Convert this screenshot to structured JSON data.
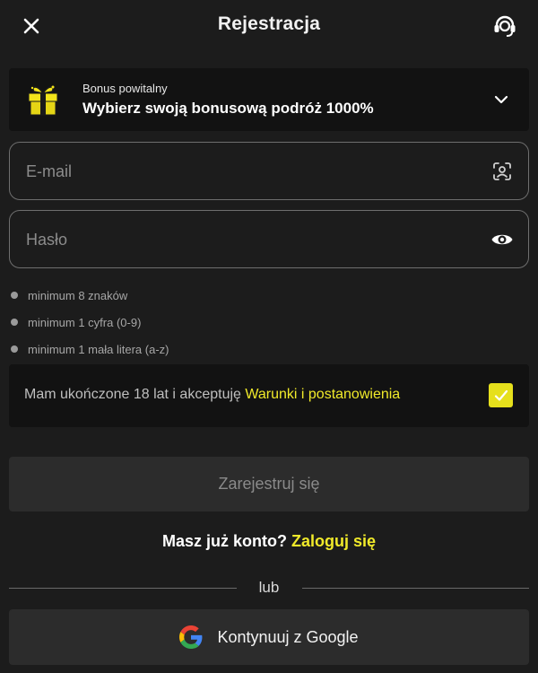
{
  "header": {
    "title": "Rejestracja",
    "close_icon": "close-icon",
    "support_icon": "headset-support-icon"
  },
  "bonus": {
    "subtitle": "Bonus powitalny",
    "title": "Wybierz swoją bonusową podróż 1000%",
    "icon": "gift-icon",
    "expand_icon": "chevron-down-icon"
  },
  "form": {
    "email": {
      "placeholder": "E-mail",
      "value": "",
      "icon": "face-scan-icon"
    },
    "password": {
      "placeholder": "Hasło",
      "value": "",
      "icon": "eye-icon"
    }
  },
  "password_requirements": [
    "minimum 8 znaków",
    "minimum 1 cyfra (0-9)",
    "minimum 1 mała litera (a-z)"
  ],
  "terms": {
    "text": "Mam ukończone 18 lat i akceptuję ",
    "link": "Warunki i postanowienia",
    "checked": true
  },
  "register_button": "Zarejestruj się",
  "login": {
    "question": "Masz już konto? ",
    "link": "Zaloguj się"
  },
  "divider_text": "lub",
  "google": {
    "label": "Kontynuuj z Google",
    "icon": "google-logo-icon"
  },
  "colors": {
    "background": "#1c1c1c",
    "card": "#121212",
    "accent": "#f0ea2a",
    "button": "#2c2c2c"
  }
}
